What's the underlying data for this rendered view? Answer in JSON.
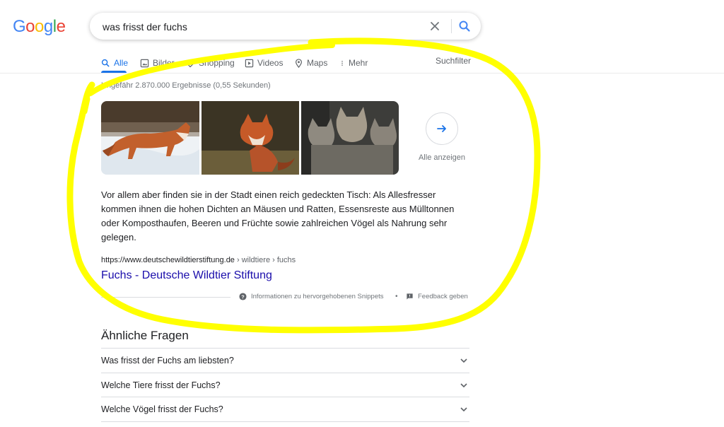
{
  "logo": {
    "text": "Google"
  },
  "search": {
    "query": "was frisst der fuchs"
  },
  "tabs": [
    {
      "label": "Alle"
    },
    {
      "label": "Bilder"
    },
    {
      "label": "Shopping"
    },
    {
      "label": "Videos"
    },
    {
      "label": "Maps"
    },
    {
      "label": "Mehr"
    }
  ],
  "toolbar": {
    "filter_label": "Suchfilter"
  },
  "stats": "Ungefähr 2.870.000 Ergebnisse (0,55 Sekunden)",
  "images": {
    "show_all_label": "Alle anzeigen"
  },
  "snippet": {
    "text": "Vor allem aber finden sie in der Stadt einen reich gedeckten Tisch: Als Allesfresser kommen ihnen die hohen Dichten an Mäusen und Ratten, Essensreste aus Mülltonnen oder Komposthaufen, Beeren und Früchte sowie zahlreichen Vögel als Nahrung sehr gelegen.",
    "site": "https://www.deutschewildtierstiftung.de",
    "path": " › wildtiere › fuchs",
    "title": "Fuchs - Deutsche Wildtier Stiftung",
    "info_label": "Informationen zu hervorgehobenen Snippets",
    "separator": "•",
    "feedback_label": "Feedback geben"
  },
  "related": {
    "title": "Ähnliche Fragen",
    "questions": [
      "Was frisst der Fuchs am liebsten?",
      "Welche Tiere frisst der Fuchs?",
      "Welche Vögel frisst der Fuchs?"
    ]
  },
  "colors": {
    "accent": "#1a73e8",
    "link": "#1a0dab",
    "annotation": "#ffff00"
  }
}
